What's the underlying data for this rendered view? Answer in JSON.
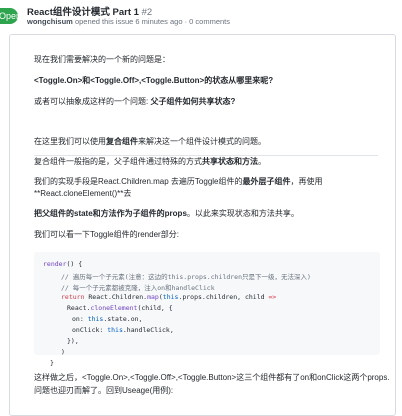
{
  "header": {
    "state_label": "Open",
    "title": "React组件设计模式 Part 1",
    "number": "#2",
    "author": "wongchisum",
    "meta_rest": "opened this issue 6 minutes ago · 0 comments"
  },
  "body": {
    "p1": "现在我们需要解决的一个新的问题是：",
    "p2_bold": "<Toggle.On>和<Toggle.Off>,<Toggle.Button>的状态从哪里来呢?",
    "p3_prefix": "或者可以抽象成这样的一个问题: ",
    "p3_bold": "父子组件如何共享状态?",
    "p4_prefix": "在这里我们可以使用",
    "p4_bold": "复合组件",
    "p4_suffix": "来解决这一个组件设计模式的问题。",
    "p5_prefix": "复合组件一般指的是，父子组件通过特殊的方式",
    "p5_bold": "共享状态和方法",
    "p5_suffix": "。",
    "p6_prefix": "我们的实现手段是React.Children.map 去遍历Toggle组件的",
    "p6_bold": "最外层子组件",
    "p6_suffix": "，再使用",
    "p7": "**React.cloneElement()**去",
    "p8_bold1": "把父组件的state和方法作为子组件的props",
    "p8_mid": "。以此来实现状态和方法共享。",
    "p9": "我们可以看一下Toggle组件的render部分:",
    "p10": "这样做之后，<Toggle.On>,<Toggle.Off>,<Toggle.Button>这三个组件都有了on和onClick这两个props.",
    "p11": "问题也迎刃而解了。回到Useage(用例):"
  },
  "code": {
    "l1_fn": "render",
    "l1_rest": "() {",
    "l2": "// 遍历每一个子元素(注意：这边的this.props.children只是下一级，无法深入)",
    "l3": "// 每一个子元素都被克隆，注入on和handleClick",
    "l4_kw": "return",
    "l4_a": " React.Children.",
    "l4_fn": "map",
    "l4_b": "(",
    "l4_this": "this",
    "l4_c": ".props.children, child ",
    "l4_op": "=>",
    "l5_a": "React.",
    "l5_fn": "cloneElement",
    "l5_b": "(child, {",
    "l6_a": "on: ",
    "l6_this": "this",
    "l6_b": ".state.on,",
    "l7_a": "onClick: ",
    "l7_this": "this",
    "l7_b": ".handleClick,",
    "l8": "}),",
    "l9": ")",
    "l10": "}"
  }
}
